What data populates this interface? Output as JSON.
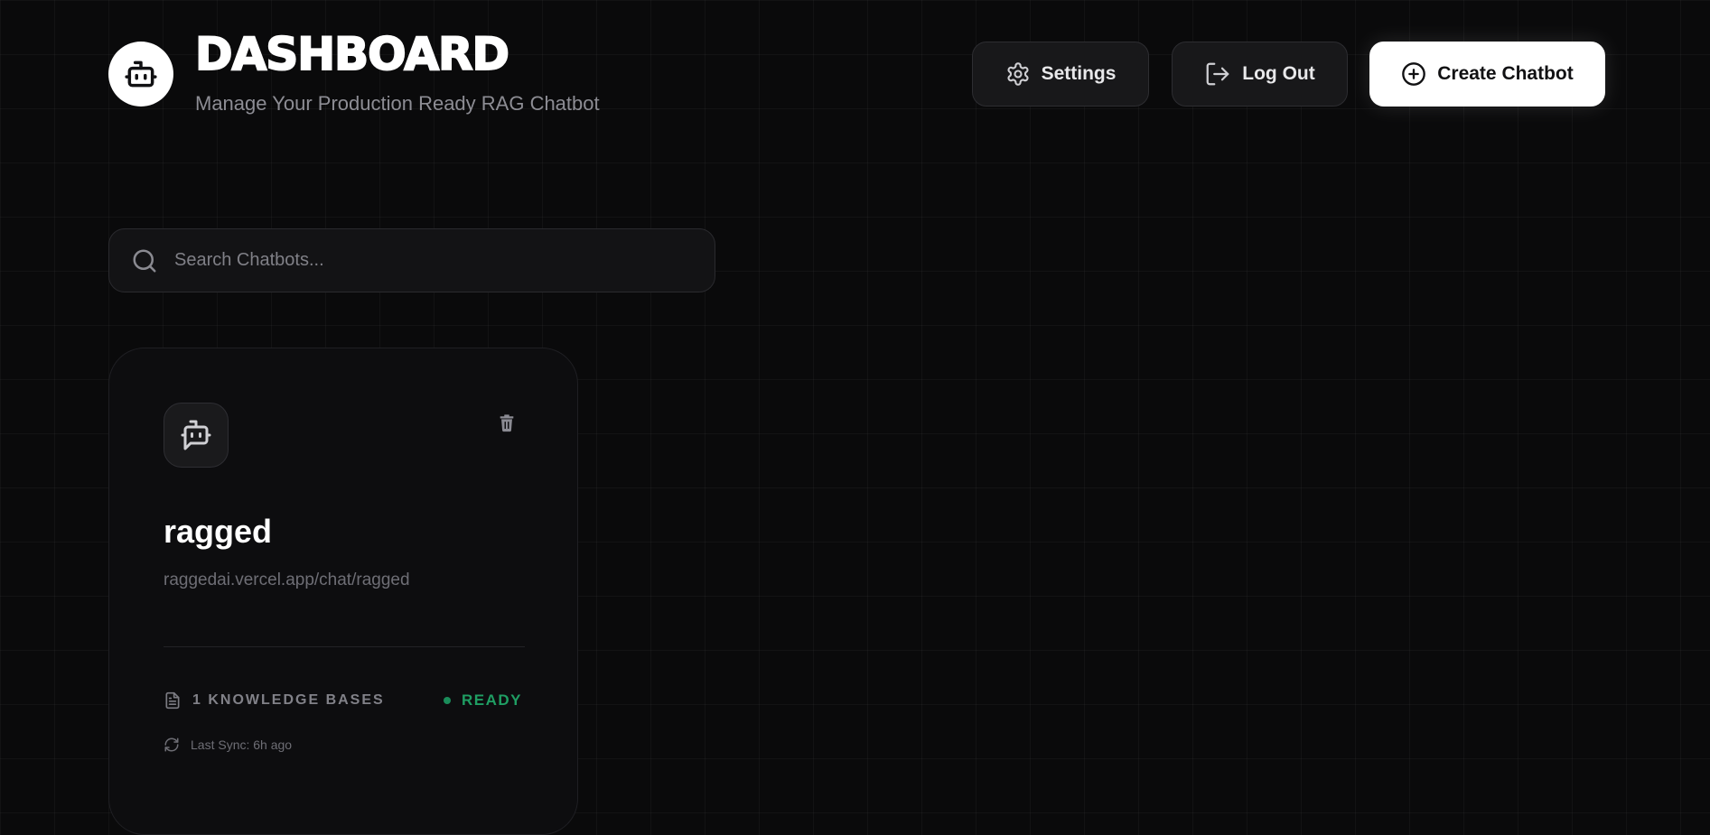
{
  "header": {
    "title": "DASHBOARD",
    "subtitle": "Manage Your Production Ready RAG Chatbot",
    "logo_icon": "robot-icon"
  },
  "actions": {
    "settings_label": "Settings",
    "settings_icon": "gear-icon",
    "logout_label": "Log Out",
    "logout_icon": "logout-icon",
    "create_label": "Create Chatbot",
    "create_icon": "plus-circle-icon"
  },
  "search": {
    "placeholder": "Search Chatbots...",
    "value": "",
    "icon": "search-icon"
  },
  "chatbots": [
    {
      "name": "ragged",
      "url": "raggedai.vercel.app/chat/ragged",
      "knowledge_bases": "1 KNOWLEDGE BASES",
      "status": "READY",
      "last_sync": "Last Sync: 6h ago",
      "icon": "bot-message-icon",
      "delete_icon": "trash-icon"
    }
  ],
  "colors": {
    "background": "#0a0a0b",
    "status_ready": "#1f9e63",
    "primary_button": "#ffffff"
  }
}
